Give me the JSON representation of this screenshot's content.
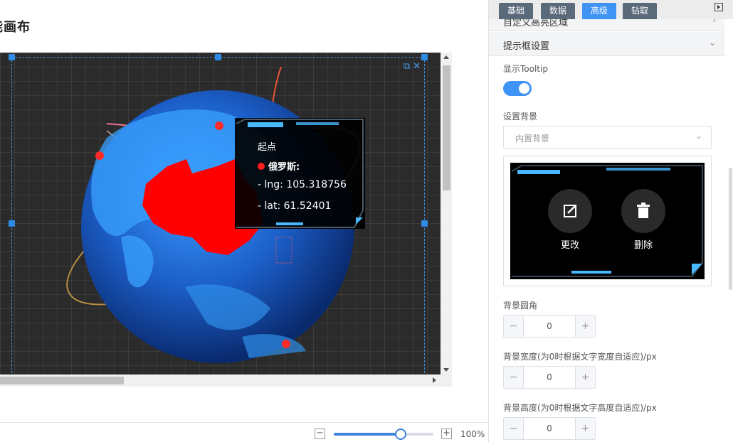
{
  "canvas": {
    "title": "能画布",
    "zoom_level": "100%",
    "zoom_percent": 67
  },
  "tooltip": {
    "title": "起点",
    "name": "俄罗斯:",
    "lng": "- lng: 105.318756",
    "lat": "- lat: 61.52401",
    "dot_color": "#ff1e1e"
  },
  "panel": {
    "tabs": [
      {
        "label": "基础",
        "active": false
      },
      {
        "label": "数据",
        "active": false
      },
      {
        "label": "高级",
        "active": true
      },
      {
        "label": "钻取",
        "active": false
      }
    ],
    "section_prev": "自定义高亮区域",
    "section_tooltip": "提示框设置",
    "show_tooltip_label": "显示Tooltip",
    "show_tooltip_on": true,
    "bg_label": "设置背景",
    "bg_select": "内置背景",
    "edit_label": "更改",
    "delete_label": "删除",
    "radius_label": "背景圆角",
    "radius_value": "0",
    "width_label": "背景宽度(为0时根据文字宽度自适应)/px",
    "width_value": "0",
    "height_label": "背景高度(为0时根据文字高度自适应)/px",
    "height_value": "0",
    "minus": "−",
    "plus": "+"
  },
  "colors": {
    "accent": "#3f93f5",
    "highlight_country": "#ff0000",
    "globe_blue": "#1f6fd8"
  }
}
